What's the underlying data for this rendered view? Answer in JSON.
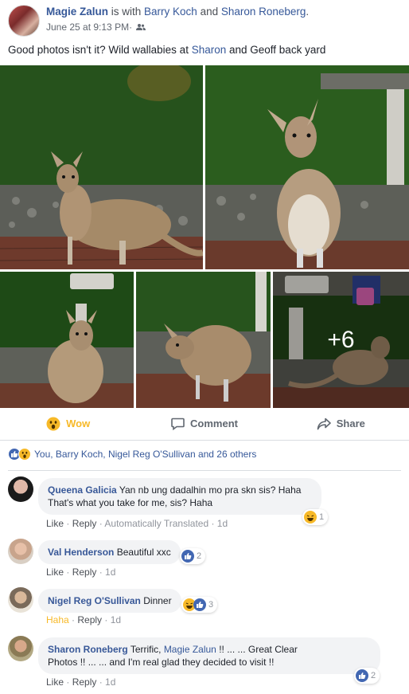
{
  "post": {
    "author": "Magie Zalun",
    "with_text": " is with ",
    "tagged1": "Barry Koch",
    "and_text": " and ",
    "tagged2": "Sharon Roneberg",
    "period": ".",
    "time": "June 25 at 9:13 PM",
    "dot": " · ",
    "privacy_icon": "friends-icon",
    "text_before": "Good photos isn't it? Wild wallabies at ",
    "text_link": "Sharon",
    "text_after": " and Geoff back yard",
    "more_photos": "+6"
  },
  "actions": {
    "wow": "Wow",
    "comment": "Comment",
    "share": "Share"
  },
  "reactions": {
    "summary": "You, Barry Koch, Nigel Reg O'Sullivan and 26 others"
  },
  "comments": [
    {
      "name": "Queena Galicia",
      "line1": "Yan nb ung dadalhin mo pra skn sis? Haha",
      "line2": "That's what you take for me, sis? Haha",
      "like": "Like",
      "reply": "Reply",
      "translated": "Automatically Translated",
      "time": "1d",
      "reaction_count": "1",
      "reaction": "haha"
    },
    {
      "name": "Val Henderson",
      "text": "Beautiful xxc",
      "like": "Like",
      "reply": "Reply",
      "time": "1d",
      "reaction_count": "2",
      "reaction": "like"
    },
    {
      "name": "Nigel Reg O'Sullivan",
      "text": "Dinner",
      "like": "Haha",
      "reply": "Reply",
      "time": "1d",
      "reaction_count": "3",
      "reaction": "haha-like"
    },
    {
      "name": "Sharon Roneberg",
      "text_a": "Terrific, ",
      "mention": "Magie Zalun",
      "text_b": " !! ... ... Great Clear",
      "line2": "Photos !! ... ... and I'm real glad they decided to visit !!",
      "like": "Like",
      "reply": "Reply",
      "time": "1d",
      "reaction_count": "2",
      "reaction": "like"
    }
  ],
  "colors": {
    "link": "#365899",
    "wow": "#f7b928",
    "like": "#4267b2",
    "bubble": "#f2f3f5"
  }
}
